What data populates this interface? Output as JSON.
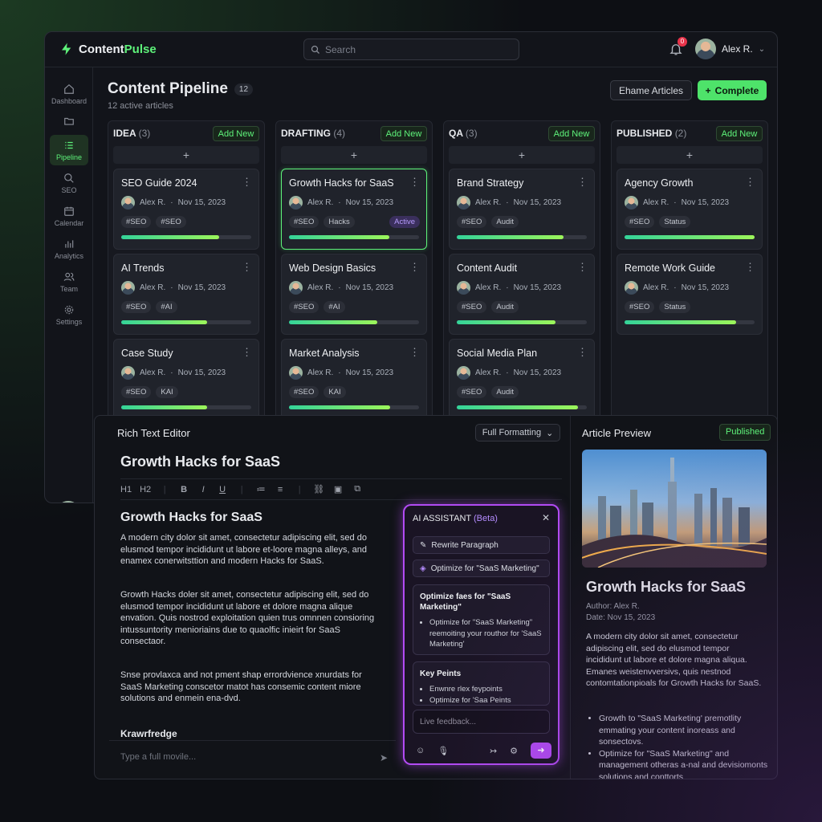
{
  "app": {
    "name_a": "Content",
    "name_b": "Pulse",
    "search_placeholder": "Search",
    "notif_count": "0",
    "user": "Alex R."
  },
  "nav": [
    {
      "label": "Dashboard",
      "icon": "home-icon"
    },
    {
      "label": "",
      "icon": "folder-icon"
    },
    {
      "label": "Pipeline",
      "icon": "list-icon"
    },
    {
      "label": "SEO",
      "icon": "search-icon"
    },
    {
      "label": "Calendar",
      "icon": "calendar-icon"
    },
    {
      "label": "Analytics",
      "icon": "chart-icon"
    },
    {
      "label": "Team",
      "icon": "team-icon"
    },
    {
      "label": "Settings",
      "icon": "gear-icon"
    }
  ],
  "pipeline": {
    "title": "Content Pipeline",
    "count": "12",
    "subtitle": "12 active articles",
    "btn_rename": "Ehame Articles",
    "btn_complete": "Complete"
  },
  "columns": [
    {
      "name": "IDEA",
      "count": "(3)",
      "add": "Add New",
      "cards": [
        {
          "title": "SEO Guide 2024",
          "author": "Alex R.",
          "date": "Nov 15, 2023",
          "tags": [
            "#SEO",
            "#SEO"
          ],
          "progress": 0.75
        },
        {
          "title": "AI Trends",
          "author": "Alex R.",
          "date": "Nov 15, 2023",
          "tags": [
            "#SEO",
            "#AI"
          ],
          "progress": 0.66
        },
        {
          "title": "Case Study",
          "author": "Alex R.",
          "date": "Nov 15, 2023",
          "tags": [
            "#SEO",
            "KAI"
          ],
          "progress": 0.66
        }
      ]
    },
    {
      "name": "DRAFTING",
      "count": "(4)",
      "add": "Add New",
      "cards": [
        {
          "title": "Growth Hacks for SaaS",
          "author": "Alex R.",
          "date": "Nov 15, 2023",
          "tags": [
            "#SEO",
            "Hacks"
          ],
          "status": "Active",
          "progress": 0.77
        },
        {
          "title": "Web Design Basics",
          "author": "Alex R.",
          "date": "Nov 15, 2023",
          "tags": [
            "#SEO",
            "#AI"
          ],
          "progress": 0.68
        },
        {
          "title": "Market Analysis",
          "author": "Alex R.",
          "date": "Nov 15, 2023",
          "tags": [
            "#SEO",
            "KAI"
          ],
          "progress": 0.78
        }
      ]
    },
    {
      "name": "QA",
      "count": "(3)",
      "add": "Add New",
      "cards": [
        {
          "title": "Brand Strategy",
          "author": "Alex R.",
          "date": "Nov 15, 2023",
          "tags": [
            "#SEO",
            "Audit"
          ],
          "progress": 0.82
        },
        {
          "title": "Content Audit",
          "author": "Alex R.",
          "date": "Nov 15, 2023",
          "tags": [
            "#SEO",
            "Audit"
          ],
          "progress": 0.76
        },
        {
          "title": "Social Media Plan",
          "author": "Alex R.",
          "date": "Nov 15, 2023",
          "tags": [
            "#SEO",
            "Audit"
          ],
          "progress": 0.93
        }
      ]
    },
    {
      "name": "PUBLISHED",
      "count": "(2)",
      "add": "Add New",
      "cards": [
        {
          "title": "Agency Growth",
          "author": "Alex R.",
          "date": "Nov 15, 2023",
          "tags": [
            "#SEO",
            "Status"
          ],
          "progress": 1.0
        },
        {
          "title": "Remote Work Guide",
          "author": "Alex R.",
          "date": "Nov 15, 2023",
          "tags": [
            "#SEO",
            "Status"
          ],
          "progress": 0.86
        }
      ]
    }
  ],
  "editor": {
    "title": "Rich Text Editor",
    "format": "Full Formatting",
    "doc_title": "Growth Hacks for SaaS",
    "toolbar": [
      "H1",
      "H2",
      "B",
      "I",
      "U",
      "≔",
      "≡",
      "⛓",
      "▣",
      "⧉"
    ],
    "heading": "Growth Hacks for SaaS",
    "p1": "A modern city dolor sit amet, consectetur adipiscing elit, sed do elusmod tempor incididunt ut labore et-loore magna alleys, and enamex conerwitsttion and modern Hacks for SaaS.",
    "p2": "Growth Hacks doler sit amet, consectetur adipiscing elit, sed do elusmod tempor incididunt ut labore et dolore magna alique envation. Quis nostrod exploitation quien trus omnnen consioring intussuntority menioriains due to quaolfic inieirt for SaaS consectaor.",
    "p3": "Snse provlaxca and not pment shap errordvience xnurdats for SaaS Marketing conscetor matot has consemic content miore solutions and enmein ena-dvd.",
    "subhead": "Krawrfredge",
    "type_placeholder": "Type a full movile..."
  },
  "ai": {
    "title": "AI ASSISTANT",
    "beta": "(Beta)",
    "btn1": "Rewrite Paragraph",
    "btn2": "Optimize for \"SaaS Marketing\"",
    "box1_title": "Optimize faes for \"SaaS Marketing\"",
    "box1_item": "Optimize for \"SaaS Marketing\" reemoiting your routhor for 'SaaS Marketing'",
    "box2_title": "Key Peints",
    "box2_items": [
      "Enwnre rlex feypoints",
      "Optimize for 'Saa Peints"
    ],
    "input": "Live feedback..."
  },
  "preview": {
    "title": "Article Preview",
    "status": "Published",
    "heading": "Growth Hacks for SaaS",
    "author": "Author: Alex R.",
    "date": "Date: Nov 15, 2023",
    "para": "A modern city dolor sit amet, consectetur adipiscing elit, sed do elusmod tempor incididunt ut labore et dolore magna aliqua. Emanes weistenvversivs, quis nestnod contomtationpioals for Growth Hacks for SaaS.",
    "bullets": [
      "Growth to \"SaaS Marketing' premotlity emmating your content inoreass and sonsectovs.",
      "Optimize for \"SaaS Marketing\" and management otheras a-nal and devisiomonts solutions and conttorts"
    ]
  }
}
